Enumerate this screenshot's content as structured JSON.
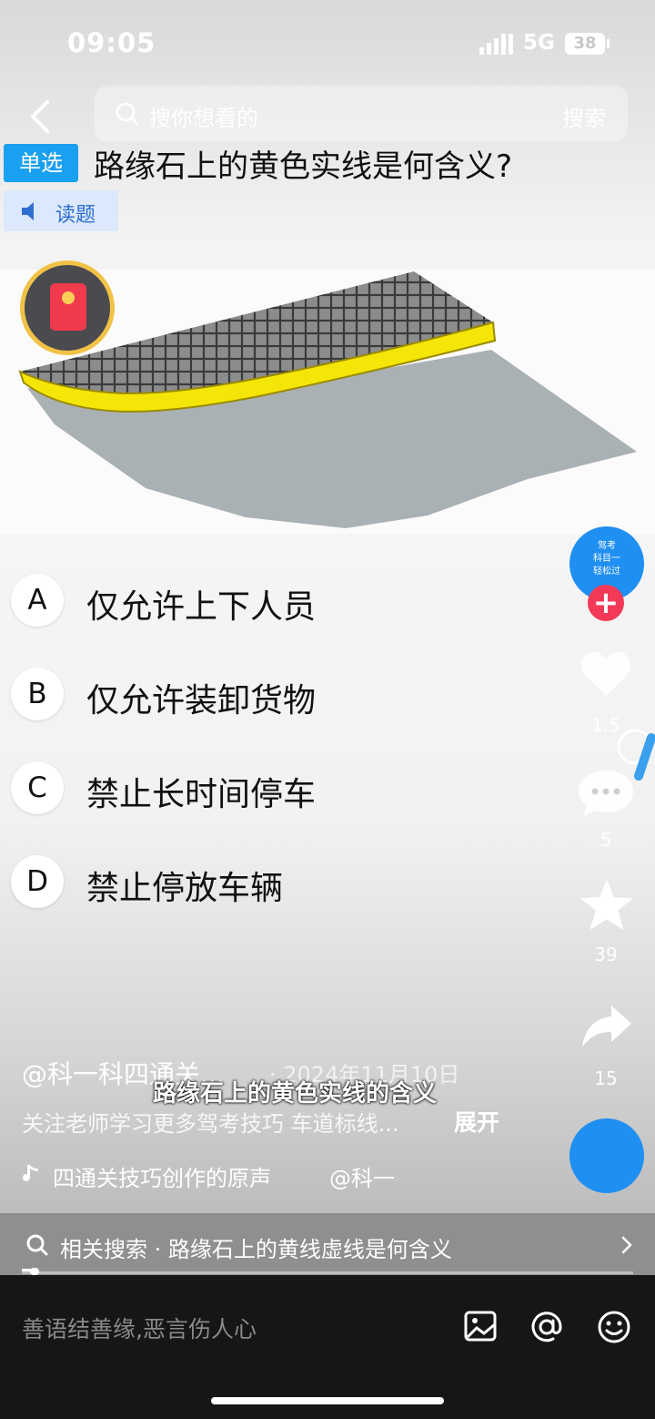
{
  "status_bar": {
    "time": "09:05",
    "network": "5G",
    "battery": "38"
  },
  "search": {
    "placeholder": "搜你想看的",
    "button": "搜索"
  },
  "quiz": {
    "type_tag": "单选",
    "question": "路缘石上的黄色实线是何含义?",
    "read_label": "读题",
    "options": [
      {
        "letter": "A",
        "text": "仅允许上下人员"
      },
      {
        "letter": "B",
        "text": "仅允许装卸货物"
      },
      {
        "letter": "C",
        "text": "禁止长时间停车"
      },
      {
        "letter": "D",
        "text": "禁止停放车辆"
      }
    ]
  },
  "sidebar": {
    "avatar_lines": [
      "驾考",
      "科目一",
      "轻松过"
    ],
    "likes": "1.5",
    "comments": "5",
    "favorites": "39",
    "shares": "15"
  },
  "post": {
    "author": "@科一科四通关...",
    "date": "· 2024年11月10日",
    "caption": "路缘石上的黄色实线的含义",
    "description": "关注老师学习更多驾考技巧 车道标线...",
    "more": "展开",
    "music": "四通关技巧创作的原声",
    "music_at": "@科一"
  },
  "related": {
    "text": "相关搜索 · 路缘石上的黄线虚线是何含义"
  },
  "progress": 0.02,
  "comment": {
    "placeholder": "善语结善缘,恶言伤人心"
  },
  "colors": {
    "accent_blue": "#1aa0f0",
    "follow_red": "#f23a58",
    "curb_yellow": "#f5e60a"
  }
}
